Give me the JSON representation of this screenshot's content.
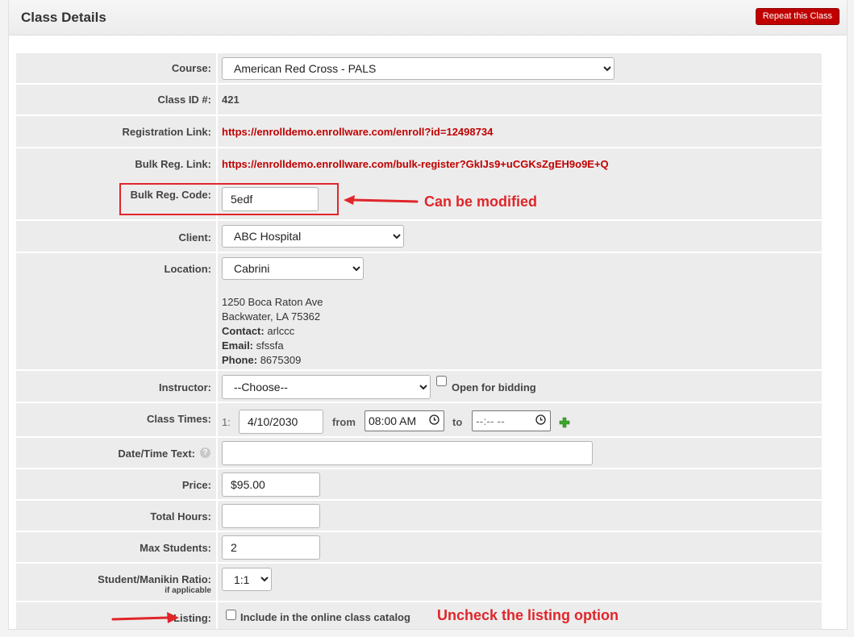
{
  "header": {
    "title": "Class Details",
    "repeat_button": "Repeat this Class"
  },
  "form": {
    "course": {
      "label": "Course:",
      "value": "American Red Cross - PALS"
    },
    "class_id": {
      "label": "Class ID #:",
      "value": "421"
    },
    "registration_link": {
      "label": "Registration Link:",
      "value": "https://enrolldemo.enrollware.com/enroll?id=12498734"
    },
    "bulk_reg_link": {
      "label": "Bulk Reg. Link:",
      "value": "https://enrolldemo.enrollware.com/bulk-register?GkIJs9+uCGKsZgEH9o9E+Q"
    },
    "bulk_reg_code": {
      "label": "Bulk Reg. Code:",
      "value": "5edf"
    },
    "client": {
      "label": "Client:",
      "value": "ABC Hospital"
    },
    "location": {
      "label": "Location:",
      "value": "Cabrini",
      "address1": "1250 Boca Raton Ave",
      "address2": "Backwater, LA 75362",
      "contact_label": "Contact:",
      "contact": "arlccc",
      "email_label": "Email:",
      "email": "sfssfa",
      "phone_label": "Phone:",
      "phone": "8675309"
    },
    "instructor": {
      "label": "Instructor:",
      "value": "--Choose--",
      "bidding_label": "Open for bidding"
    },
    "class_times": {
      "label": "Class Times:",
      "index": "1:",
      "date": "4/10/2030",
      "from_label": "from",
      "from_value": "08:00 AM",
      "to_label": "to",
      "to_value": "--:-- --"
    },
    "datetime_text": {
      "label": "Date/Time Text:",
      "help_icon": "?",
      "value": ""
    },
    "price": {
      "label": "Price:",
      "value": "$95.00"
    },
    "total_hours": {
      "label": "Total Hours:",
      "value": ""
    },
    "max_students": {
      "label": "Max Students:",
      "value": "2"
    },
    "ratio": {
      "label": "Student/Manikin Ratio:",
      "sublabel": "if applicable",
      "value": "1:1"
    },
    "listing": {
      "label": "Listing:",
      "checkbox_label": "Include in the online class catalog"
    }
  },
  "annotations": {
    "modified_note": "Can be modified",
    "listing_note": "Uncheck the listing option"
  },
  "colors": {
    "accent": "#c00000",
    "annotation": "#e0262a",
    "row_bg": "#ececec"
  },
  "icons": {
    "add": "plus-icon",
    "help": "help-icon",
    "clock": "clock-icon"
  }
}
